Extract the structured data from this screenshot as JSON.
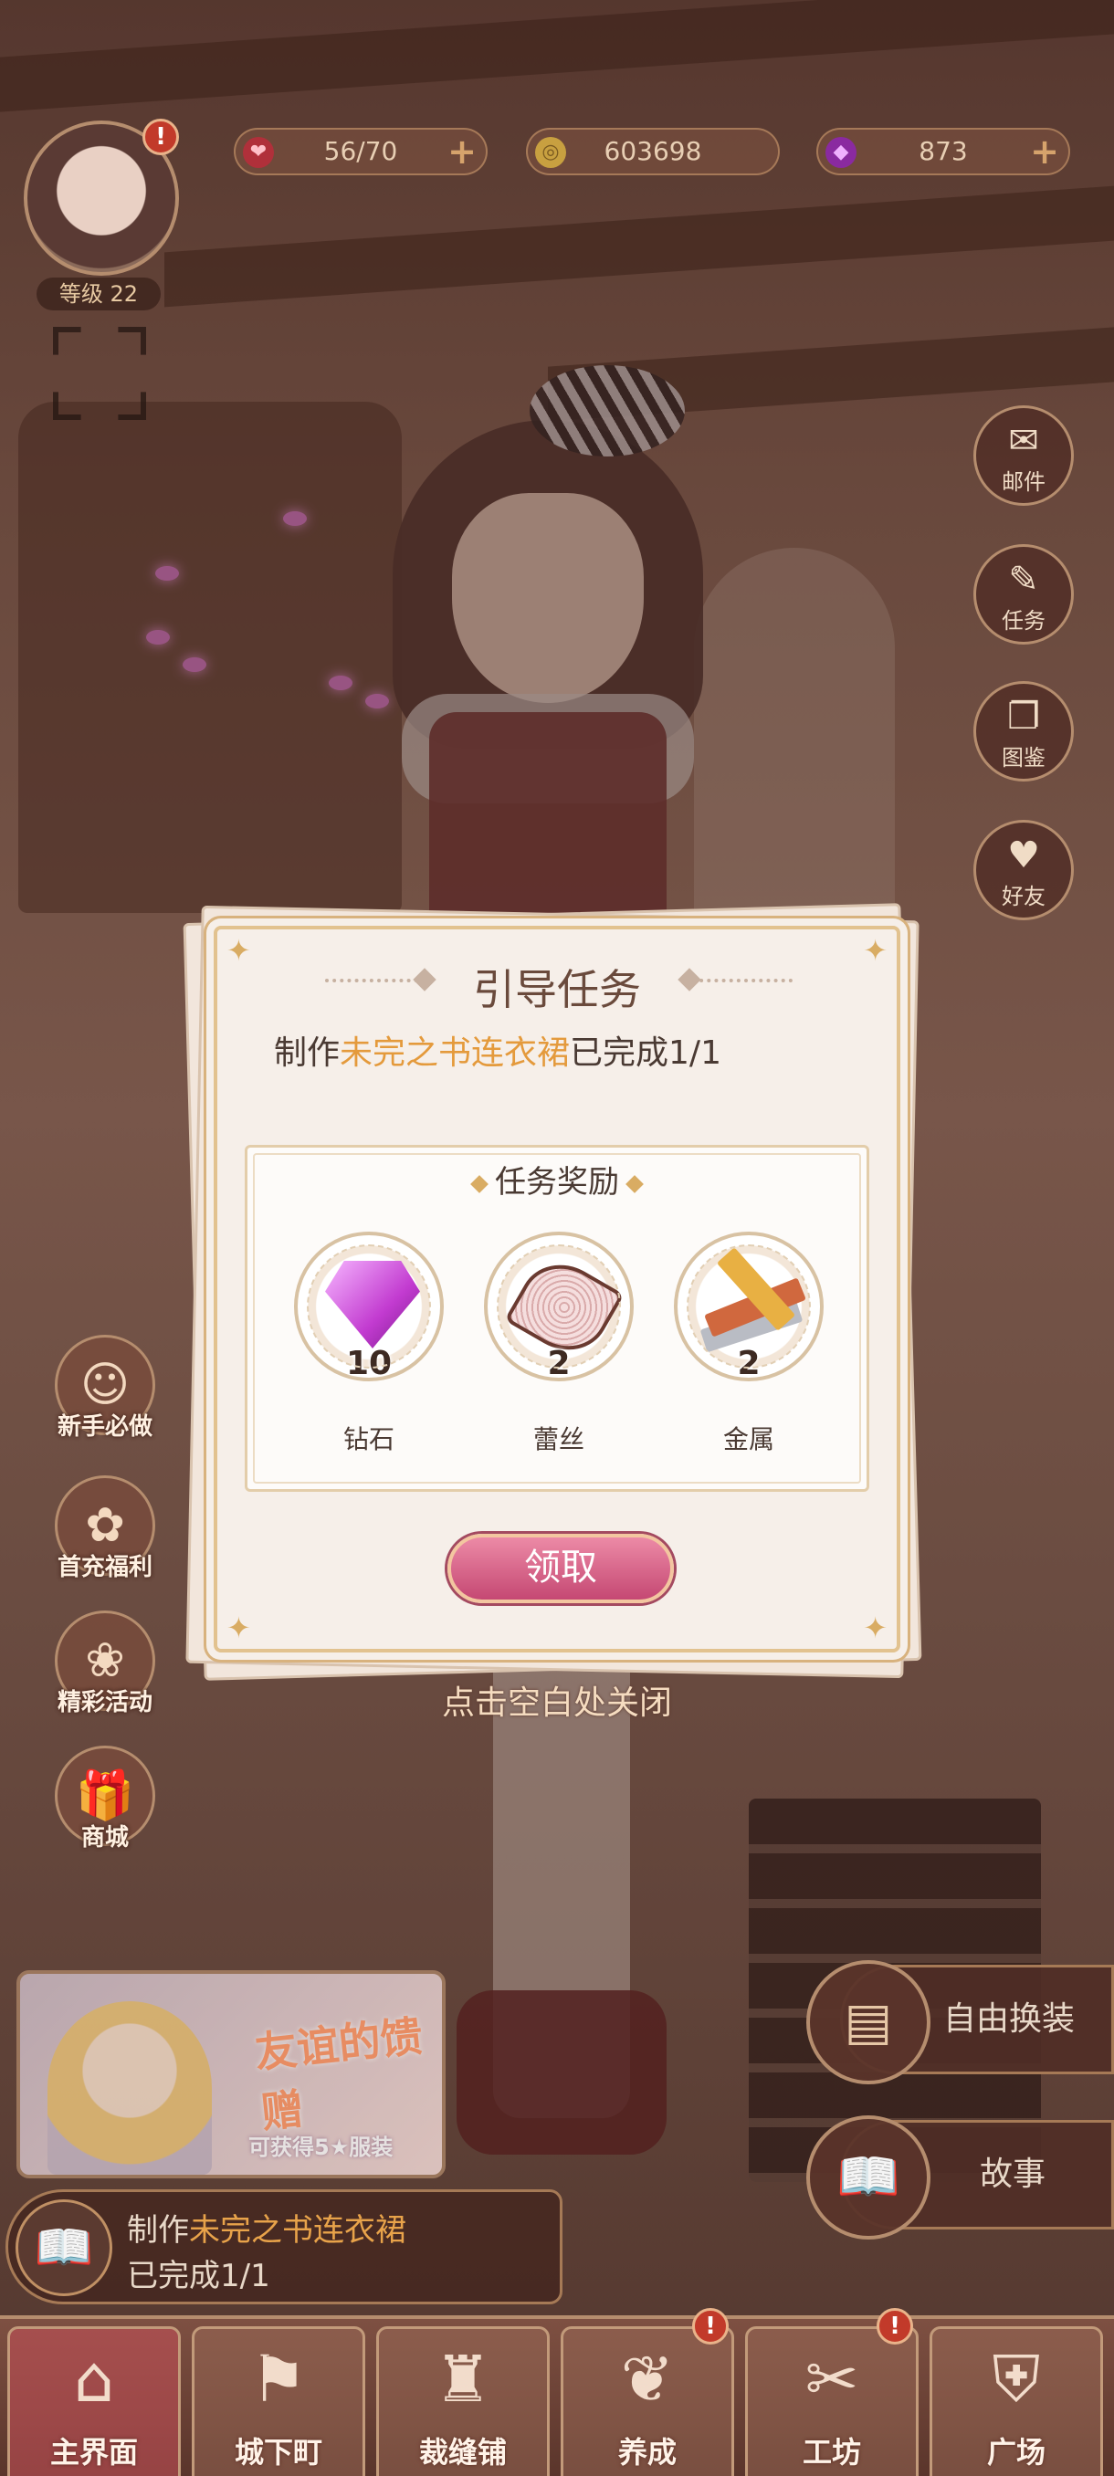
{
  "colors": {
    "highlight": "#e49a3c",
    "claim_button": "#c54873",
    "alert": "#c23a2a"
  },
  "player": {
    "level_label": "等级 22",
    "alert": "!"
  },
  "resources": [
    {
      "icon": "heart-icon",
      "value": "56/70",
      "has_plus": true
    },
    {
      "icon": "coin-icon",
      "value": "603698",
      "has_plus": false
    },
    {
      "icon": "gem-icon",
      "value": "873",
      "has_plus": true
    }
  ],
  "side_buttons": [
    {
      "label": "邮件",
      "icon": "mail-icon"
    },
    {
      "label": "任务",
      "icon": "task-icon"
    },
    {
      "label": "图鉴",
      "icon": "collection-icon"
    },
    {
      "label": "好友",
      "icon": "friends-icon"
    }
  ],
  "left_buttons": [
    {
      "label": "新手必做",
      "icon": "newbie-icon"
    },
    {
      "label": "首充福利",
      "icon": "first-recharge-icon"
    },
    {
      "label": "精彩活动",
      "icon": "events-icon"
    },
    {
      "label": "商城",
      "icon": "shop-icon"
    }
  ],
  "banner": {
    "title": "友谊的馈赠",
    "subtitle": "可获得5★服装"
  },
  "quest_bar": {
    "prefix": "制作",
    "item": "未完之书连衣裙",
    "status": "已完成1/1"
  },
  "right_actions": [
    {
      "label": "自由换装",
      "icon": "wardrobe-icon"
    },
    {
      "label": "故事",
      "icon": "story-icon"
    }
  ],
  "nav": [
    {
      "label": "主界面",
      "icon": "home-icon",
      "active": true,
      "alert": false
    },
    {
      "label": "城下町",
      "icon": "town-icon",
      "active": false,
      "alert": false
    },
    {
      "label": "裁缝铺",
      "icon": "tailor-icon",
      "active": false,
      "alert": false
    },
    {
      "label": "养成",
      "icon": "growth-icon",
      "active": false,
      "alert": true
    },
    {
      "label": "工坊",
      "icon": "workshop-icon",
      "active": false,
      "alert": true
    },
    {
      "label": "广场",
      "icon": "plaza-icon",
      "active": false,
      "alert": false
    }
  ],
  "dialog": {
    "title": "引导任务",
    "desc_prefix": "制作",
    "desc_item": "未完之书连衣裙",
    "desc_status": "已完成1/1",
    "reward_title": "任务奖励",
    "rewards": [
      {
        "name": "钻石",
        "count": "10",
        "icon": "diamond-icon"
      },
      {
        "name": "蕾丝",
        "count": "2",
        "icon": "lace-icon"
      },
      {
        "name": "金属",
        "count": "2",
        "icon": "metal-icon"
      }
    ],
    "claim_label": "领取",
    "close_hint": "点击空白处关闭"
  }
}
